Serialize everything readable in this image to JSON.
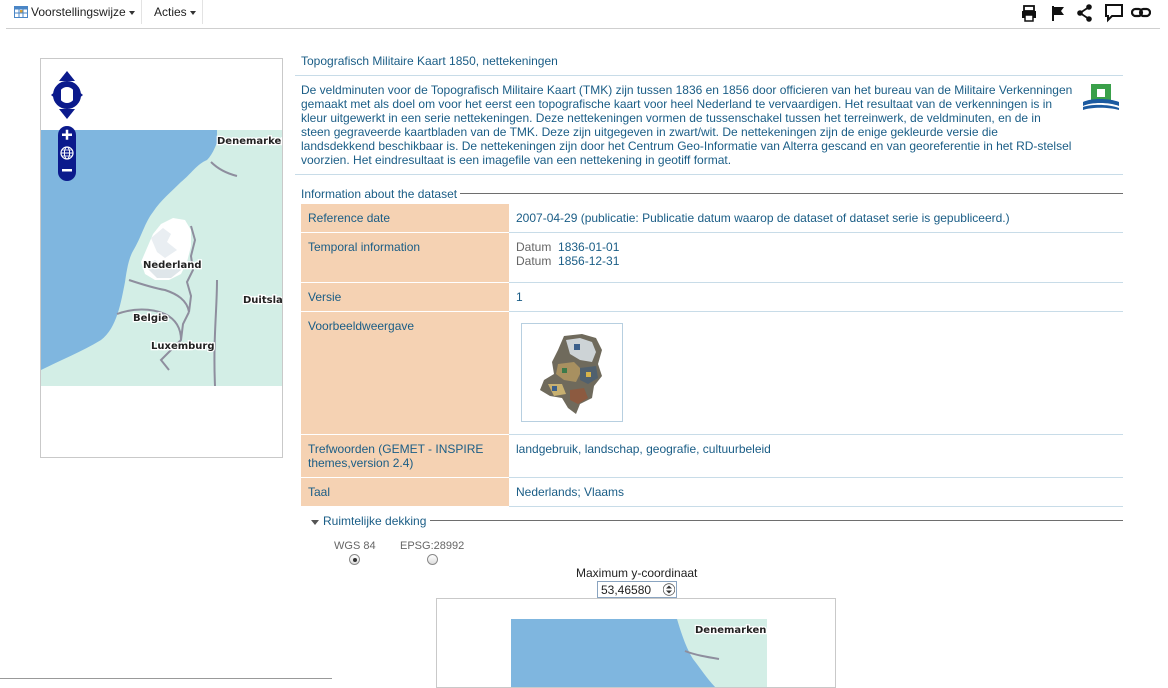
{
  "toolbar": {
    "view_label": "Voorstellingswijze",
    "actions_label": "Acties",
    "icons": [
      "print-icon",
      "flag-icon",
      "share-icon",
      "comment-icon",
      "link-icon"
    ]
  },
  "map": {
    "labels": {
      "denmark": "Denemarken",
      "netherlands": "Nederland",
      "germany": "Duitsland",
      "belgium": "Belgie",
      "luxembourg": "Luxemburg"
    }
  },
  "record": {
    "title": "Topografisch Militaire Kaart 1850, nettekeningen",
    "abstract": "De veldminuten voor de Topografisch Militaire Kaart (TMK) zijn tussen 1836 en 1856 door officieren van het bureau van de Militaire Verkenningen gemaakt met als doel om voor het eerst een topografische kaart voor heel Nederland te vervaardigen. Het resultaat van de verkenningen is in kleur uitgewerkt in een serie nettekeningen. Deze nettekeningen vormen de tussenschakel tussen het terreinwerk, de veldminuten, en de in steen gegraveerde kaartbladen van de TMK. Deze zijn uitgegeven in zwart/wit. De nettekeningen zijn de enige gekleurde versie die landsdekkend beschikbaar is. De nettekeningen zijn door het Centrum Geo-Informatie van Alterra gescand en van georeferentie in het RD-stelsel voorzien. Het eindresultaat is een imagefile van een nettekening in geotiff format."
  },
  "dataset": {
    "legend": "Information about the dataset",
    "rows": {
      "reference_date": {
        "label": "Reference date",
        "value": "2007-04-29 (publicatie: Publicatie datum waarop de dataset of dataset serie is gepubliceerd.)"
      },
      "temporal": {
        "label": "Temporal information",
        "date_label": "Datum",
        "start": "1836-01-01",
        "end": "1856-12-31"
      },
      "version": {
        "label": "Versie",
        "value": "1"
      },
      "preview": {
        "label": "Voorbeeldweergave"
      },
      "keywords": {
        "label": "Trefwoorden (GEMET - INSPIRE themes,version 2.4)",
        "value": "landgebruik, landschap, geografie, cultuurbeleid"
      },
      "language": {
        "label": "Taal",
        "value": "Nederlands; Vlaams"
      }
    }
  },
  "spatial": {
    "legend": "Ruimtelijke dekking",
    "crs_options": [
      {
        "label": "WGS 84",
        "selected": true
      },
      {
        "label": "EPSG:28992",
        "selected": false
      }
    ],
    "max_y_label": "Maximum y-coordinaat",
    "max_y_value": "53,46580",
    "map_label": "Denemarken"
  },
  "colors": {
    "link": "#1a5d86",
    "label_bg": "#f5d2b3",
    "sea": "#7fb6df",
    "land": "#d3eee6",
    "control": "#0b1a8c"
  }
}
